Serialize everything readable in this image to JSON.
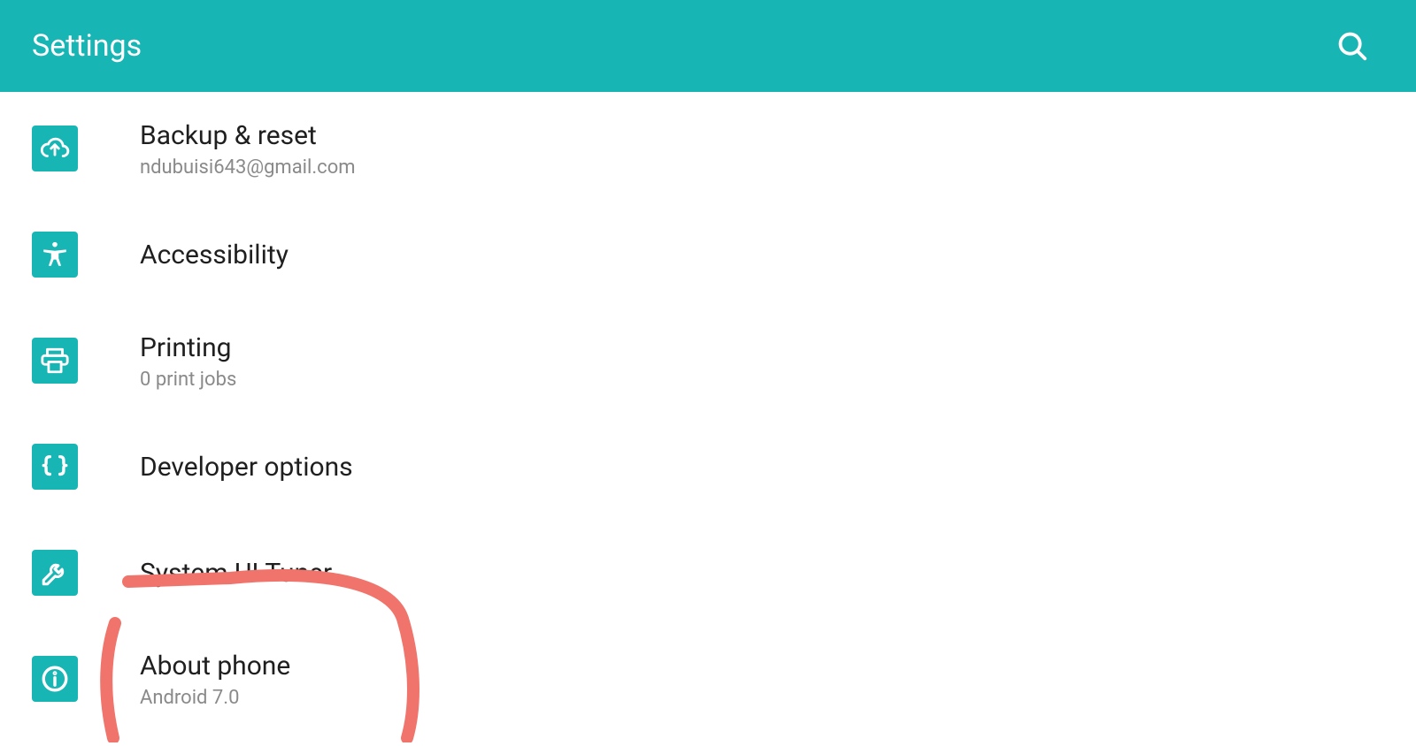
{
  "header": {
    "title": "Settings"
  },
  "items": [
    {
      "name": "backup-reset",
      "title": "Backup & reset",
      "sub": "ndubuisi643@gmail.com",
      "icon": "cloud-upload-icon"
    },
    {
      "name": "accessibility",
      "title": "Accessibility",
      "sub": "",
      "icon": "accessibility-icon"
    },
    {
      "name": "printing",
      "title": "Printing",
      "sub": "0 print jobs",
      "icon": "printer-icon"
    },
    {
      "name": "developer-options",
      "title": "Developer options",
      "sub": "",
      "icon": "braces-icon"
    },
    {
      "name": "system-ui-tuner",
      "title": "System UI Tuner",
      "sub": "",
      "icon": "wrench-icon"
    },
    {
      "name": "about-phone",
      "title": "About phone",
      "sub": "Android 7.0",
      "icon": "info-icon"
    }
  ]
}
